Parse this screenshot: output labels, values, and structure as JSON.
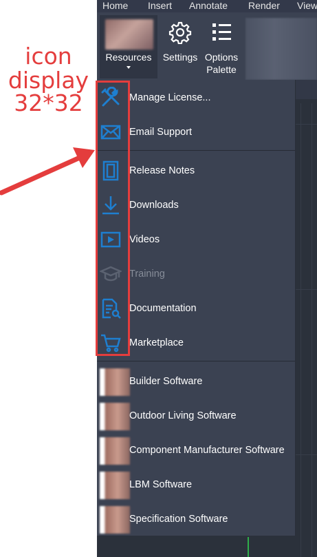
{
  "menubar": {
    "tabs": [
      "Home",
      "Insert",
      "Annotate",
      "Render",
      "View"
    ]
  },
  "ribbon": {
    "resources_label": "Resources",
    "settings_label": "Settings",
    "options_palette_line1": "Options",
    "options_palette_line2": "Palette"
  },
  "menu": {
    "group1": [
      {
        "label": "Manage License...",
        "icon": "tools-icon"
      },
      {
        "label": "Email Support",
        "icon": "envelope-icon"
      }
    ],
    "group2": [
      {
        "label": "Release Notes",
        "icon": "notes-icon"
      },
      {
        "label": "Downloads",
        "icon": "download-icon"
      },
      {
        "label": "Videos",
        "icon": "video-icon"
      },
      {
        "label": "Training",
        "icon": "graduation-cap-icon",
        "disabled": true
      },
      {
        "label": "Documentation",
        "icon": "document-search-icon"
      },
      {
        "label": "Marketplace",
        "icon": "cart-icon"
      }
    ],
    "group3": [
      {
        "label": "Builder Software"
      },
      {
        "label": "Outdoor Living Software"
      },
      {
        "label": "Component Manufacturer Software"
      },
      {
        "label": "LBM Software"
      },
      {
        "label": "Specification Software"
      }
    ]
  },
  "annotation": {
    "line1": "icon",
    "line2": "display",
    "line3": "32*32"
  },
  "colors": {
    "icon_blue": "#1e7fd0",
    "annotation_red": "#e43d3d",
    "menu_bg": "#3b4252"
  }
}
